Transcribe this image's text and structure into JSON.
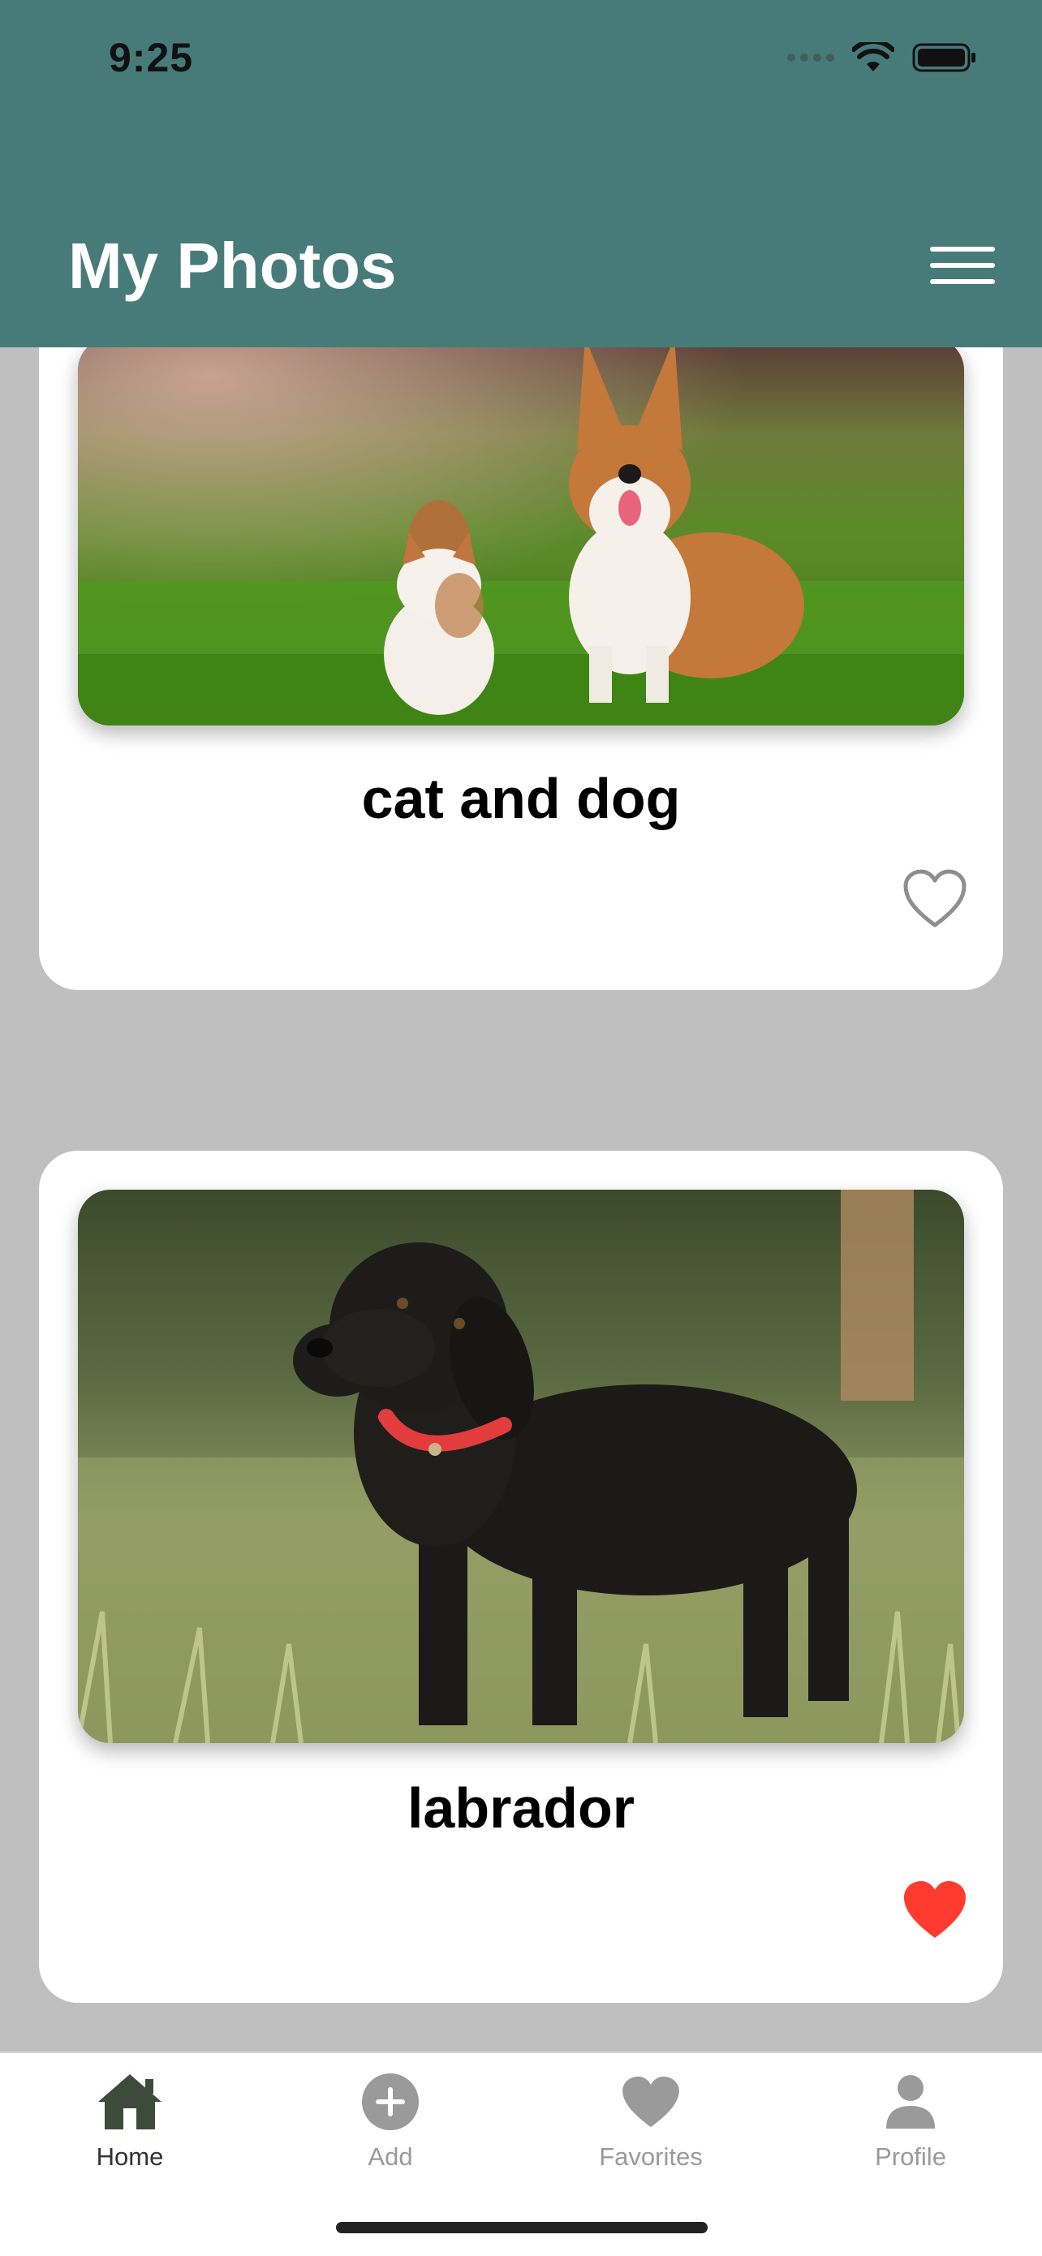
{
  "status_bar": {
    "time": "9:25"
  },
  "header": {
    "title": "My Photos",
    "menu_icon": "hamburger-menu-icon"
  },
  "colors": {
    "header": "#477b7a",
    "favorite_active": "#ff3b30",
    "favorite_inactive": "#8e8e8e",
    "tab_active": "#3d4b3b",
    "tab_inactive": "#9a9a9a"
  },
  "photos": [
    {
      "title": "cat and dog",
      "favorite": false
    },
    {
      "title": "labrador",
      "favorite": true
    }
  ],
  "tabs": [
    {
      "label": "Home",
      "icon": "home-icon",
      "active": true
    },
    {
      "label": "Add",
      "icon": "plus-circle-icon",
      "active": false
    },
    {
      "label": "Favorites",
      "icon": "heart-icon",
      "active": false
    },
    {
      "label": "Profile",
      "icon": "person-icon",
      "active": false
    }
  ]
}
